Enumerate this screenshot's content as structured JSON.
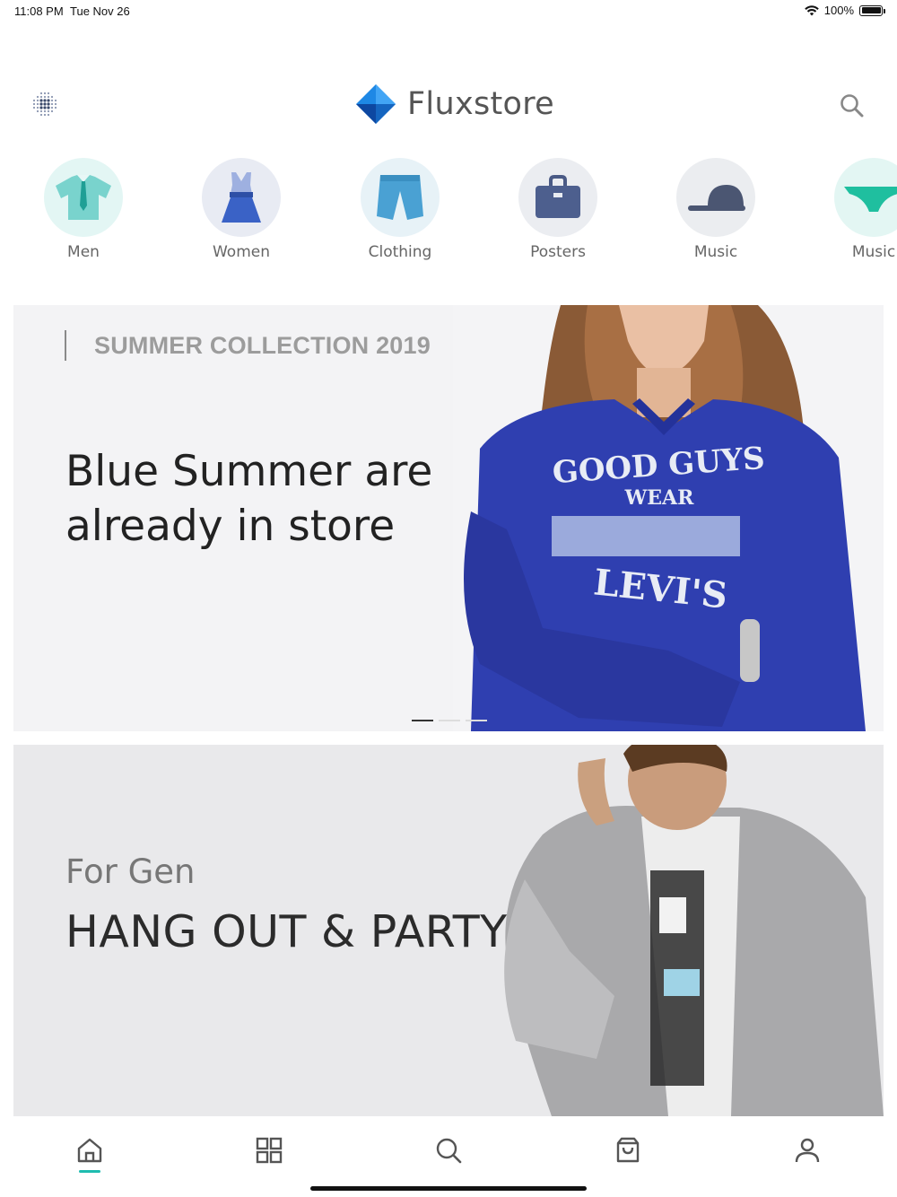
{
  "status_bar": {
    "time": "11:08 PM",
    "date": "Tue Nov 26",
    "battery": "100%",
    "battery_level": 1.0,
    "icons": [
      "wifi-icon",
      "battery-icon"
    ]
  },
  "header": {
    "brand_name": "Fluxstore",
    "icons": [
      "menu-dots-icon",
      "fluxstore-logo",
      "search-icon"
    ]
  },
  "categories": [
    {
      "label": "Men",
      "icon": "shirt-icon",
      "bg": "#e3f6f4"
    },
    {
      "label": "Women",
      "icon": "dress-icon",
      "bg": "#e8ebf3"
    },
    {
      "label": "Clothing",
      "icon": "shorts-icon",
      "bg": "#e7f2f7"
    },
    {
      "label": "Posters",
      "icon": "bag-icon",
      "bg": "#ebedf1"
    },
    {
      "label": "Music",
      "icon": "cap-icon",
      "bg": "#ebedf0"
    },
    {
      "label": "Music",
      "icon": "underwear-icon",
      "bg": "#e3f6f3"
    }
  ],
  "banners": [
    {
      "subtitle": "SUMMER COLLECTION 2019",
      "title": "Blue Summer are already in store",
      "slide_count": 3,
      "active_slide": 1
    },
    {
      "subtitle": "For Gen",
      "title": "HANG OUT & PARTY"
    }
  ],
  "bottom_nav": {
    "items": [
      "home-icon",
      "grid-icon",
      "search-icon",
      "cart-icon",
      "user-icon"
    ],
    "active": "home-icon"
  },
  "colors": {
    "accent": "#1ebcb0",
    "logo_blue": "#1e88e5",
    "logo_dark": "#0d47a1",
    "sweater_blue": "#2f3fb0"
  }
}
